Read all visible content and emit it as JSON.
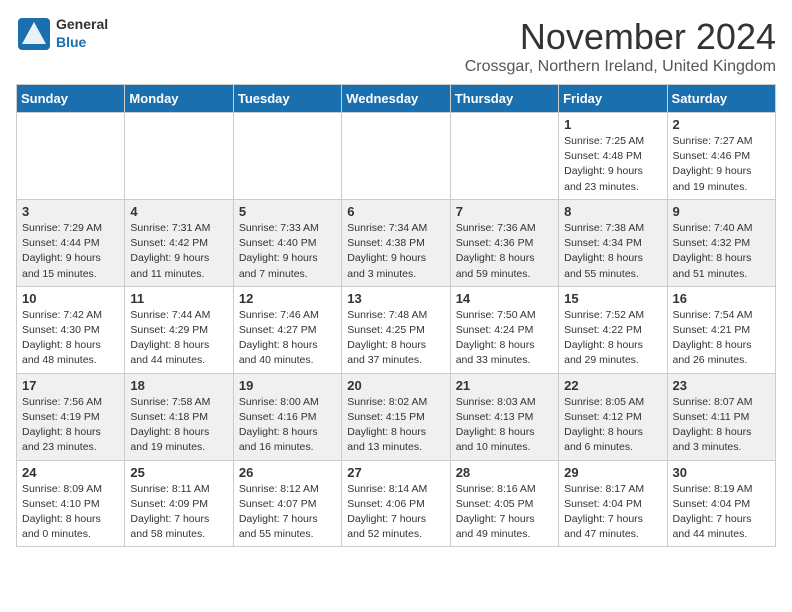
{
  "logo": {
    "general": "General",
    "blue": "Blue"
  },
  "title": "November 2024",
  "subtitle": "Crossgar, Northern Ireland, United Kingdom",
  "days_of_week": [
    "Sunday",
    "Monday",
    "Tuesday",
    "Wednesday",
    "Thursday",
    "Friday",
    "Saturday"
  ],
  "weeks": [
    [
      {
        "day": "",
        "info": ""
      },
      {
        "day": "",
        "info": ""
      },
      {
        "day": "",
        "info": ""
      },
      {
        "day": "",
        "info": ""
      },
      {
        "day": "",
        "info": ""
      },
      {
        "day": "1",
        "info": "Sunrise: 7:25 AM\nSunset: 4:48 PM\nDaylight: 9 hours and 23 minutes."
      },
      {
        "day": "2",
        "info": "Sunrise: 7:27 AM\nSunset: 4:46 PM\nDaylight: 9 hours and 19 minutes."
      }
    ],
    [
      {
        "day": "3",
        "info": "Sunrise: 7:29 AM\nSunset: 4:44 PM\nDaylight: 9 hours and 15 minutes."
      },
      {
        "day": "4",
        "info": "Sunrise: 7:31 AM\nSunset: 4:42 PM\nDaylight: 9 hours and 11 minutes."
      },
      {
        "day": "5",
        "info": "Sunrise: 7:33 AM\nSunset: 4:40 PM\nDaylight: 9 hours and 7 minutes."
      },
      {
        "day": "6",
        "info": "Sunrise: 7:34 AM\nSunset: 4:38 PM\nDaylight: 9 hours and 3 minutes."
      },
      {
        "day": "7",
        "info": "Sunrise: 7:36 AM\nSunset: 4:36 PM\nDaylight: 8 hours and 59 minutes."
      },
      {
        "day": "8",
        "info": "Sunrise: 7:38 AM\nSunset: 4:34 PM\nDaylight: 8 hours and 55 minutes."
      },
      {
        "day": "9",
        "info": "Sunrise: 7:40 AM\nSunset: 4:32 PM\nDaylight: 8 hours and 51 minutes."
      }
    ],
    [
      {
        "day": "10",
        "info": "Sunrise: 7:42 AM\nSunset: 4:30 PM\nDaylight: 8 hours and 48 minutes."
      },
      {
        "day": "11",
        "info": "Sunrise: 7:44 AM\nSunset: 4:29 PM\nDaylight: 8 hours and 44 minutes."
      },
      {
        "day": "12",
        "info": "Sunrise: 7:46 AM\nSunset: 4:27 PM\nDaylight: 8 hours and 40 minutes."
      },
      {
        "day": "13",
        "info": "Sunrise: 7:48 AM\nSunset: 4:25 PM\nDaylight: 8 hours and 37 minutes."
      },
      {
        "day": "14",
        "info": "Sunrise: 7:50 AM\nSunset: 4:24 PM\nDaylight: 8 hours and 33 minutes."
      },
      {
        "day": "15",
        "info": "Sunrise: 7:52 AM\nSunset: 4:22 PM\nDaylight: 8 hours and 29 minutes."
      },
      {
        "day": "16",
        "info": "Sunrise: 7:54 AM\nSunset: 4:21 PM\nDaylight: 8 hours and 26 minutes."
      }
    ],
    [
      {
        "day": "17",
        "info": "Sunrise: 7:56 AM\nSunset: 4:19 PM\nDaylight: 8 hours and 23 minutes."
      },
      {
        "day": "18",
        "info": "Sunrise: 7:58 AM\nSunset: 4:18 PM\nDaylight: 8 hours and 19 minutes."
      },
      {
        "day": "19",
        "info": "Sunrise: 8:00 AM\nSunset: 4:16 PM\nDaylight: 8 hours and 16 minutes."
      },
      {
        "day": "20",
        "info": "Sunrise: 8:02 AM\nSunset: 4:15 PM\nDaylight: 8 hours and 13 minutes."
      },
      {
        "day": "21",
        "info": "Sunrise: 8:03 AM\nSunset: 4:13 PM\nDaylight: 8 hours and 10 minutes."
      },
      {
        "day": "22",
        "info": "Sunrise: 8:05 AM\nSunset: 4:12 PM\nDaylight: 8 hours and 6 minutes."
      },
      {
        "day": "23",
        "info": "Sunrise: 8:07 AM\nSunset: 4:11 PM\nDaylight: 8 hours and 3 minutes."
      }
    ],
    [
      {
        "day": "24",
        "info": "Sunrise: 8:09 AM\nSunset: 4:10 PM\nDaylight: 8 hours and 0 minutes."
      },
      {
        "day": "25",
        "info": "Sunrise: 8:11 AM\nSunset: 4:09 PM\nDaylight: 7 hours and 58 minutes."
      },
      {
        "day": "26",
        "info": "Sunrise: 8:12 AM\nSunset: 4:07 PM\nDaylight: 7 hours and 55 minutes."
      },
      {
        "day": "27",
        "info": "Sunrise: 8:14 AM\nSunset: 4:06 PM\nDaylight: 7 hours and 52 minutes."
      },
      {
        "day": "28",
        "info": "Sunrise: 8:16 AM\nSunset: 4:05 PM\nDaylight: 7 hours and 49 minutes."
      },
      {
        "day": "29",
        "info": "Sunrise: 8:17 AM\nSunset: 4:04 PM\nDaylight: 7 hours and 47 minutes."
      },
      {
        "day": "30",
        "info": "Sunrise: 8:19 AM\nSunset: 4:04 PM\nDaylight: 7 hours and 44 minutes."
      }
    ]
  ]
}
